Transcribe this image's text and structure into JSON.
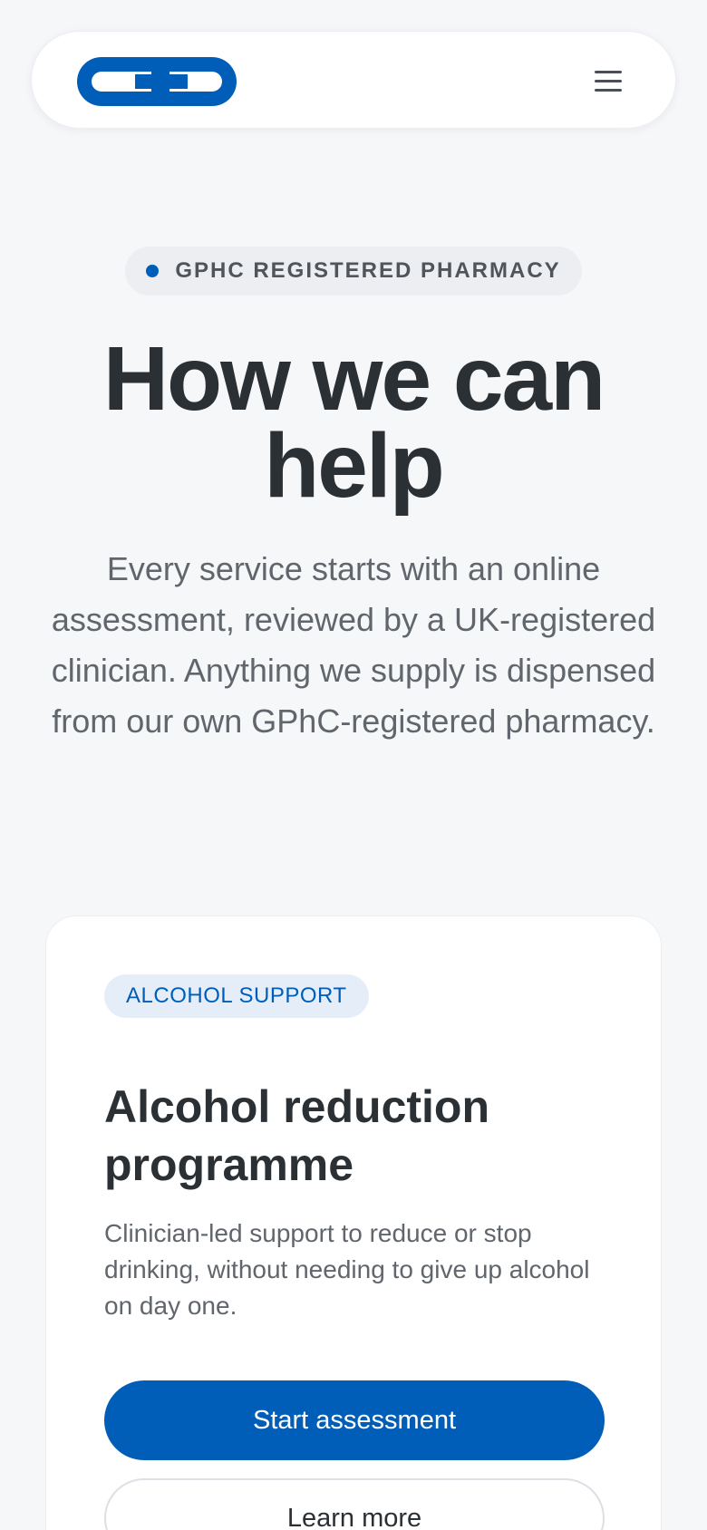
{
  "header": {
    "logo_icon": "cross-and-d-logo-icon",
    "menu_icon": "hamburger-menu-icon"
  },
  "hero": {
    "badge": "GPHC REGISTERED PHARMACY",
    "title": "How we can help",
    "subtitle": "Every service starts with an online assessment, reviewed by a UK-registered clinician. Anything we supply is dispensed from our own GPhC-registered pharmacy."
  },
  "card": {
    "tag": "ALCOHOL SUPPORT",
    "title": "Alcohol reduction programme",
    "description": "Clinician-led support to reduce or stop drinking, without needing to give up alcohol on day one.",
    "primary_button": "Start assessment",
    "secondary_button": "Learn more"
  },
  "colors": {
    "brand": "#005eb8",
    "background": "#f6f7f9",
    "text": "#2b3035",
    "muted_text": "#60666c"
  }
}
